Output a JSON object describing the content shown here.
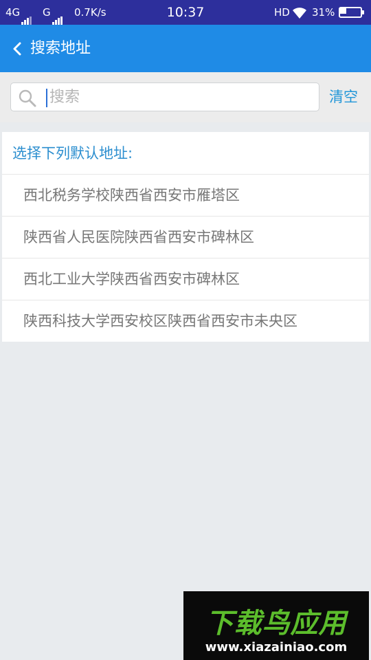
{
  "status_bar": {
    "network1": "4G",
    "network2": "G",
    "speed": "0.7K/s",
    "time": "10:37",
    "hd": "HD",
    "battery": "31%",
    "battery_level": 0.31
  },
  "app_bar": {
    "back_icon": "chevron-left-icon",
    "title": "搜索地址"
  },
  "search": {
    "placeholder": "搜索",
    "value": "",
    "icon": "search-icon",
    "clear_label": "清空"
  },
  "address_list": {
    "header": "选择下列默认地址:",
    "items": [
      {
        "label": "西北税务学校陕西省西安市雁塔区"
      },
      {
        "label": "陕西省人民医院陕西省西安市碑林区"
      },
      {
        "label": "西北工业大学陕西省西安市碑林区"
      },
      {
        "label": "陕西科技大学西安校区陕西省西安市未央区"
      }
    ]
  },
  "watermark": {
    "logo": "下载鸟应用",
    "url": "www.xiazainiao.com"
  },
  "colors": {
    "status_bar": "#2d2f9c",
    "app_bar": "#1f8be6",
    "accent": "#2196d8",
    "background": "#e8ebee"
  }
}
